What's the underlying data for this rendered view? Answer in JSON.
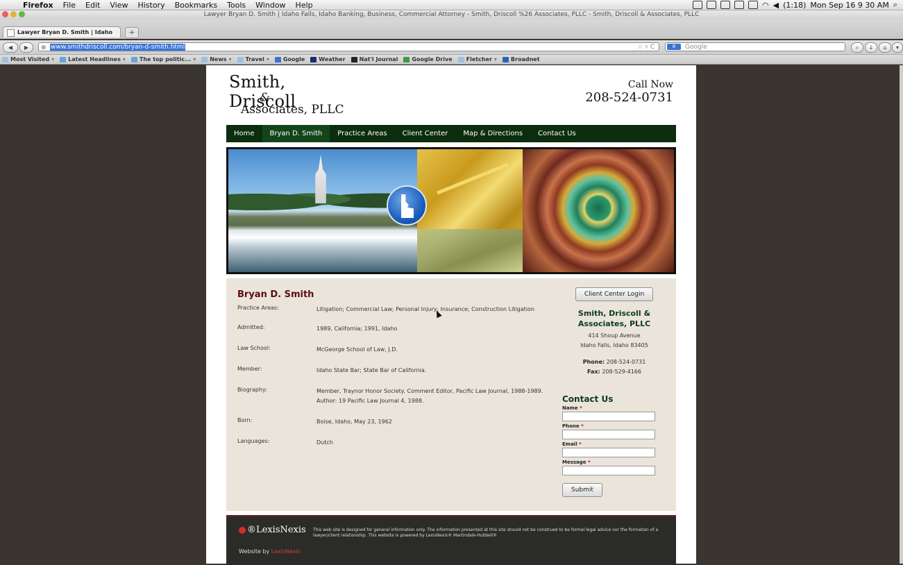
{
  "menubar": {
    "app": "Firefox",
    "items": [
      "File",
      "Edit",
      "View",
      "History",
      "Bookmarks",
      "Tools",
      "Window",
      "Help"
    ],
    "battery": "(1:18)",
    "clock": "Mon Sep 16  9 30 AM"
  },
  "window": {
    "title": "Lawyer Bryan D. Smith | Idaho Falls, Idaho Banking, Business, Commercial Attorney - Smith, Driscoll %26 Associates, PLLC - Smith, Driscoll & Associates, PLLC",
    "tab_label": "Lawyer Bryan D. Smith | Idaho F...",
    "new_tab": "+"
  },
  "navbar": {
    "url": "www.smithdriscoll.com/bryan-d-smith.html",
    "search_placeholder": "Google",
    "search_engine": "8"
  },
  "bookmarks": [
    {
      "label": "Most Visited",
      "dd": true
    },
    {
      "label": "Latest Headlines",
      "dd": true
    },
    {
      "label": "The top politic...",
      "dd": true
    },
    {
      "label": "News",
      "dd": true
    },
    {
      "label": "Travel",
      "dd": true
    },
    {
      "label": "Google",
      "dd": false
    },
    {
      "label": "Weather",
      "dd": false
    },
    {
      "label": "Nat'l Journal",
      "dd": false
    },
    {
      "label": "Google Drive",
      "dd": false
    },
    {
      "label": "Fletcher",
      "dd": true
    },
    {
      "label": "Broadnet",
      "dd": false
    }
  ],
  "site": {
    "logo_line1": "Smith, Driscoll",
    "logo_amp": "&",
    "logo_line2": "Associates, PLLC",
    "call_now": "Call Now",
    "phone": "208-524-0731",
    "nav": [
      "Home",
      "Bryan D. Smith",
      "Practice Areas",
      "Client Center",
      "Map & Directions",
      "Contact Us"
    ],
    "active_nav": 1
  },
  "attorney": {
    "name": "Bryan D. Smith",
    "rows": [
      {
        "label": "Practice Areas:",
        "value": "Litigation; Commercial Law; Personal Injury; Insurance; Construction Litigation"
      },
      {
        "label": "Admitted:",
        "value": "1989, California; 1991, Idaho"
      },
      {
        "label": "Law School:",
        "value": "McGeorge School of Law, J.D."
      },
      {
        "label": "Member:",
        "value": "Idaho State Bar; State Bar of California."
      },
      {
        "label": "Biography:",
        "value": "Member, Traynor Honor Society. Comment Editor, Pacific Law Journal, 1988-1989. Author: 19 Pacific Law Journal 4, 1988."
      },
      {
        "label": "Born:",
        "value": "Boise, Idaho, May 23, 1962"
      },
      {
        "label": "Languages:",
        "value": "Dutch"
      }
    ]
  },
  "sidebar": {
    "login_button": "Client Center Login",
    "firm_name": "Smith, Driscoll & Associates, PLLC",
    "address1": "414 Shoup Avenue",
    "address2": "Idaho Falls, Idaho 83405",
    "phone_label": "Phone:",
    "phone": "208-524-0731",
    "fax_label": "Fax:",
    "fax": "208-529-4166"
  },
  "contact_form": {
    "title": "Contact Us",
    "fields": [
      {
        "label": "Name",
        "req": "*"
      },
      {
        "label": "Phone",
        "req": "*"
      },
      {
        "label": "Email",
        "req": "*"
      },
      {
        "label": "Message",
        "req": "*"
      }
    ],
    "submit": "Submit"
  },
  "footer": {
    "brand": "LexisNexis",
    "brand_mark": "®",
    "disclaimer": "This web site is designed for general information only. The information presented at this site should not be construed to be formal legal advice nor the formation of a lawyer/client relationship. This website is powered by LexisNexis® Martindale-Hubbell®",
    "website_by": "Website by",
    "website_by_link": "LexisNexis"
  },
  "colors": {
    "nav_bg": "#0c2d0e",
    "name_color": "#5c0d0d",
    "firm_green": "#0d3b1e",
    "content_bg": "#ebe4da",
    "footer_bg": "#2b2b28"
  }
}
